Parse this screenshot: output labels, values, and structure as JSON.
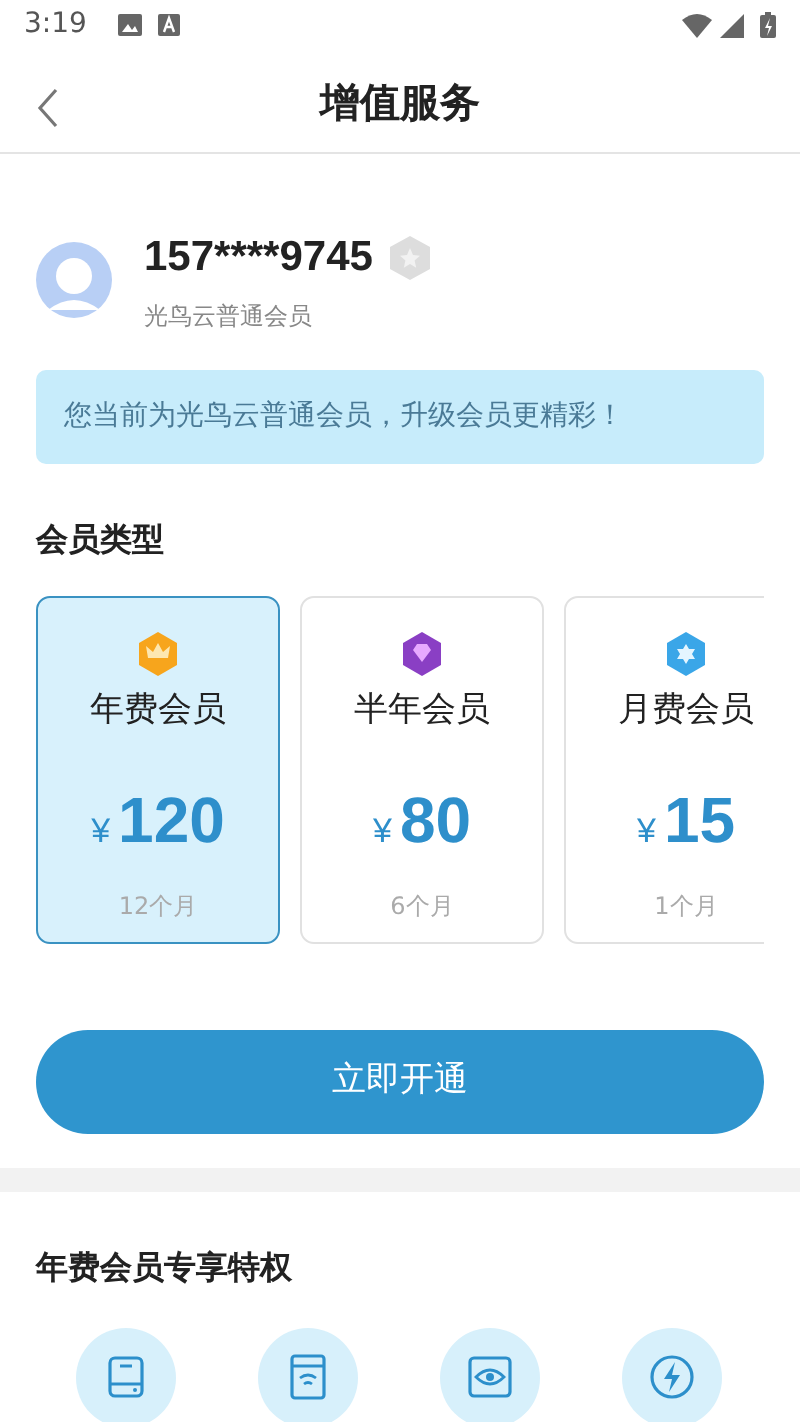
{
  "status_bar": {
    "time": "3:19"
  },
  "header": {
    "title": "增值服务"
  },
  "user": {
    "phone": "157****9745",
    "level": "光鸟云普通会员"
  },
  "notice": "您当前为光鸟云普通会员，升级会员更精彩！",
  "plans_title": "会员类型",
  "plans": [
    {
      "name": "年费会员",
      "currency": "¥",
      "price": "120",
      "period": "12个月",
      "selected": true,
      "color": "#f7a51c"
    },
    {
      "name": "半年会员",
      "currency": "¥",
      "price": "80",
      "period": "6个月",
      "selected": false,
      "color": "#8a3fc4"
    },
    {
      "name": "月费会员",
      "currency": "¥",
      "price": "15",
      "period": "1个月",
      "selected": false,
      "color": "#3aa6e8"
    }
  ],
  "action": "立即开通",
  "perks_title": "年费会员专享特权"
}
